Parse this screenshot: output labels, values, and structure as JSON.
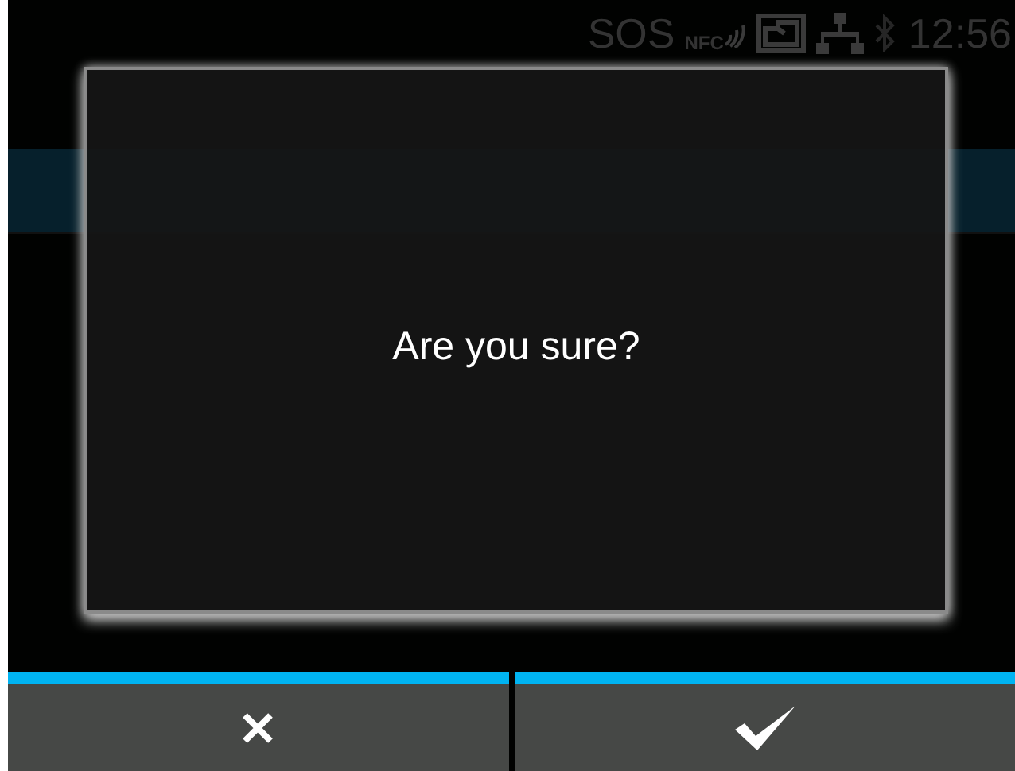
{
  "status_bar": {
    "sos": "SOS",
    "nfc": "NFC",
    "time": "12:56"
  },
  "dialog": {
    "message": "Are you sure?"
  },
  "buttons": [
    {
      "kind": "cancel"
    },
    {
      "kind": "confirm"
    }
  ]
}
